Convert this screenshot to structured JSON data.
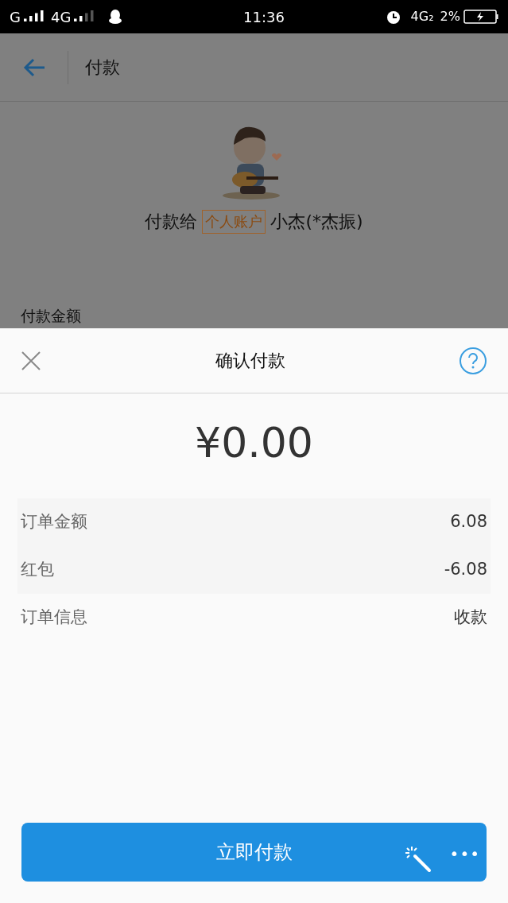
{
  "status_bar": {
    "carrier_1": "G",
    "carrier_2": "4G",
    "time": "11:36",
    "network": "4G₂",
    "battery": "2%"
  },
  "header": {
    "title": "付款"
  },
  "payee": {
    "prefix": "付款给",
    "tag": "个人账户",
    "name": "小杰(*杰振)"
  },
  "amount_label": "付款金额",
  "sheet": {
    "title": "确认付款",
    "total": "¥0.00",
    "rows": [
      {
        "label": "订单金额",
        "value": "6.08"
      },
      {
        "label": "红包",
        "value": "-6.08"
      },
      {
        "label": "订单信息",
        "value": "收款"
      }
    ],
    "pay_button": "立即付款",
    "more": "•••"
  }
}
